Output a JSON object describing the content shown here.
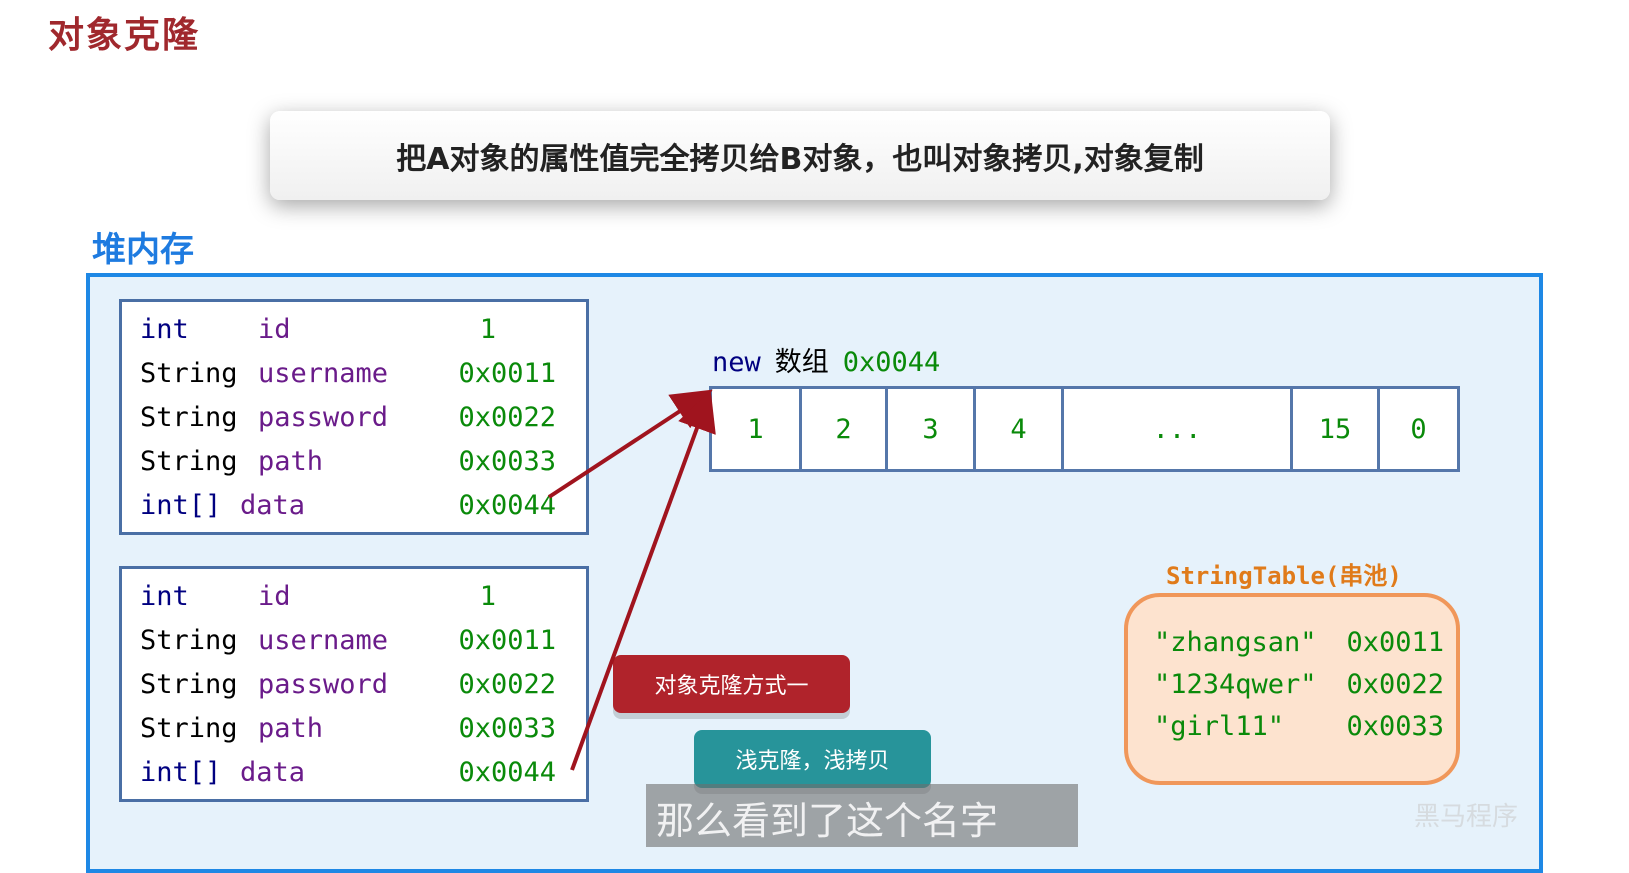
{
  "title": "对象克隆",
  "definition": "把A对象的属性值完全拷贝给B对象，也叫对象拷贝,对象复制",
  "heap_label": "堆内存",
  "objects": [
    {
      "fields": [
        {
          "type": "int",
          "name": "id",
          "value": "1"
        },
        {
          "type": "String",
          "name": "username",
          "value": "0x0011"
        },
        {
          "type": "String",
          "name": "password",
          "value": "0x0022"
        },
        {
          "type": "String",
          "name": "path",
          "value": "0x0033"
        },
        {
          "type": "int[]",
          "name": "data",
          "value": "0x0044"
        }
      ]
    },
    {
      "fields": [
        {
          "type": "int",
          "name": "id",
          "value": "1"
        },
        {
          "type": "String",
          "name": "username",
          "value": "0x0011"
        },
        {
          "type": "String",
          "name": "password",
          "value": "0x0022"
        },
        {
          "type": "String",
          "name": "path",
          "value": "0x0033"
        },
        {
          "type": "int[]",
          "name": "data",
          "value": "0x0044"
        }
      ]
    }
  ],
  "array": {
    "keyword": "new",
    "label": "数组",
    "address": "0x0044",
    "cells": [
      "1",
      "2",
      "3",
      "4",
      "...",
      "15",
      "0"
    ]
  },
  "string_table": {
    "label": "StringTable(串池)",
    "entries": [
      {
        "str": "\"zhangsan\"",
        "addr": "0x0011"
      },
      {
        "str": "\"1234qwer\"",
        "addr": "0x0022"
      },
      {
        "str": "\"girl11\"",
        "addr": "0x0033"
      }
    ]
  },
  "buttons": {
    "method_one": "对象克隆方式一",
    "shallow": "浅克隆，浅拷贝"
  },
  "subtitle": "那么看到了这个名字",
  "watermark": "黑马程序",
  "colors": {
    "title": "#a0282d",
    "heap_border": "#1e88e5",
    "arrow": "#a0141e",
    "value_green": "#0a8a0a",
    "string_table_orange": "#f0975a"
  }
}
